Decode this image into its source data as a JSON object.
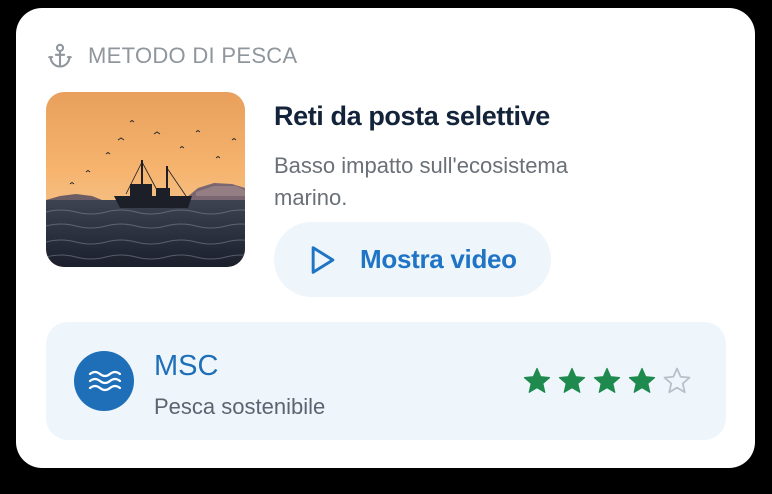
{
  "section": {
    "label": "METODO DI PESCA",
    "icon": "anchor-icon"
  },
  "method": {
    "image": "fishing-boat-sunset-photo",
    "title": "Reti da posta selettive",
    "description": "Basso impatto sull'ecosistema marino."
  },
  "video_button": {
    "label": "Mostra video",
    "icon": "play-icon"
  },
  "certification": {
    "name": "MSC",
    "subtitle": "Pesca sostenibile",
    "icon": "waves-icon",
    "rating": 4,
    "rating_max": 5
  },
  "colors": {
    "accent_blue": "#1f74c6",
    "star_green": "#1e8a4d",
    "panel_bg": "#eef5fb"
  }
}
